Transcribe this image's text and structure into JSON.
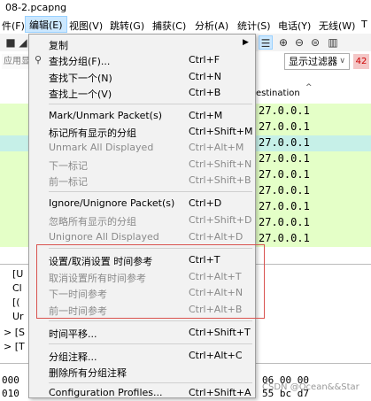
{
  "window": {
    "title": "08-2.pcapng"
  },
  "menubar": {
    "items": [
      {
        "label": "件(F)"
      },
      {
        "label": "编辑(E)"
      },
      {
        "label": "视图(V)"
      },
      {
        "label": "跳转(G)"
      },
      {
        "label": "捕获(C)"
      },
      {
        "label": "分析(A)"
      },
      {
        "label": "统计(S)"
      },
      {
        "label": "电话(Y)"
      },
      {
        "label": "无线(W)"
      },
      {
        "label": "T"
      }
    ]
  },
  "filterbar": {
    "input_text": "应用显",
    "display_filter_label": "显示过滤器",
    "badge": "42"
  },
  "packet_list": {
    "destination_header": "estination",
    "rows": [
      "27.0.0.1",
      "27.0.0.1",
      "27.0.0.1",
      "27.0.0.1",
      "27.0.0.1",
      "27.0.0.1",
      "27.0.0.1",
      "27.0.0.1",
      "27.0.0.1"
    ]
  },
  "details": {
    "lines": [
      "[U",
      "Cl",
      "[(",
      "Ur",
      "> [S",
      "> [T"
    ]
  },
  "bytes": {
    "line1_left": "000",
    "line1_right": "06 00 00",
    "line2_left": "010",
    "line2_right": "55 bc d7"
  },
  "watermark": "CSDN @Ocean&&Star",
  "edit_menu": {
    "items": [
      {
        "label": "复制",
        "shortcut": "",
        "submenu": true,
        "disabled": false
      },
      {
        "label": "查找分组(F)...",
        "shortcut": "Ctrl+F",
        "disabled": false,
        "icon": "search-icon"
      },
      {
        "label": "查找下一个(N)",
        "shortcut": "Ctrl+N",
        "disabled": false
      },
      {
        "label": "查找上一个(V)",
        "shortcut": "Ctrl+B",
        "disabled": false
      },
      {
        "label": "Mark/Unmark Packet(s)",
        "shortcut": "Ctrl+M",
        "disabled": false
      },
      {
        "label": "标记所有显示的分组",
        "shortcut": "Ctrl+Shift+M",
        "disabled": false
      },
      {
        "label": "Unmark All Displayed",
        "shortcut": "Ctrl+Alt+M",
        "disabled": true
      },
      {
        "label": "下一标记",
        "shortcut": "Ctrl+Shift+N",
        "disabled": true
      },
      {
        "label": "前一标记",
        "shortcut": "Ctrl+Shift+B",
        "disabled": true
      },
      {
        "label": "Ignore/Unignore Packet(s)",
        "shortcut": "Ctrl+D",
        "disabled": false
      },
      {
        "label": "忽略所有显示的分组",
        "shortcut": "Ctrl+Shift+D",
        "disabled": true
      },
      {
        "label": "Unignore All Displayed",
        "shortcut": "Ctrl+Alt+D",
        "disabled": true
      },
      {
        "label": "设置/取消设置 时间参考",
        "shortcut": "Ctrl+T",
        "disabled": false
      },
      {
        "label": "取消设置所有时间参考",
        "shortcut": "Ctrl+Alt+T",
        "disabled": true
      },
      {
        "label": "下一时间参考",
        "shortcut": "Ctrl+Alt+N",
        "disabled": true
      },
      {
        "label": "前一时间参考",
        "shortcut": "Ctrl+Alt+B",
        "disabled": true
      },
      {
        "label": "时间平移...",
        "shortcut": "Ctrl+Shift+T",
        "disabled": false
      },
      {
        "label": "分组注释...",
        "shortcut": "Ctrl+Alt+C",
        "disabled": false
      },
      {
        "label": "删除所有分组注释",
        "shortcut": "",
        "disabled": false
      },
      {
        "label": "Configuration Profiles...",
        "shortcut": "Ctrl+Shift+A",
        "disabled": false
      }
    ]
  },
  "colors": {
    "row_green": "#e4ffc7",
    "row_selected": "#c6f0e8",
    "menu_bg": "#f2f2f2",
    "highlight": "#91c9f7",
    "annotation_red": "#d9534f"
  }
}
